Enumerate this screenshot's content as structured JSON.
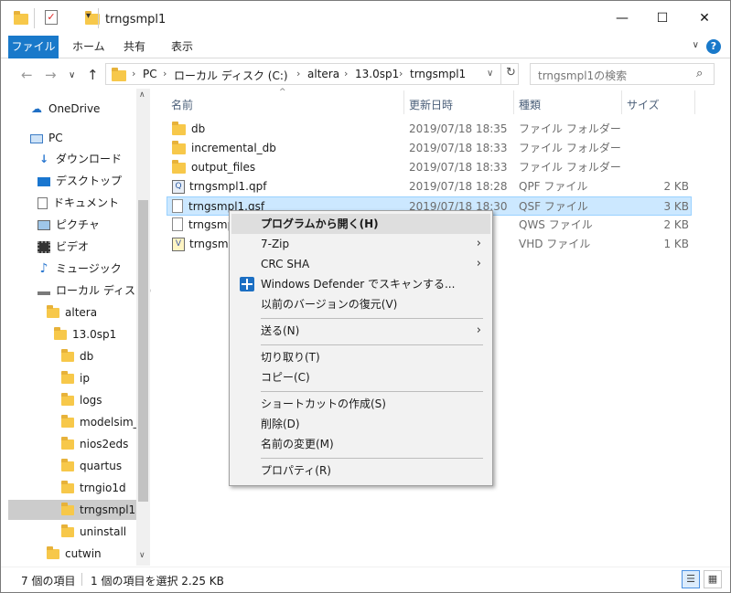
{
  "window": {
    "title": "trngsmpl1",
    "minimize": "—",
    "maximize": "☐",
    "close": "✕"
  },
  "ribbon": {
    "tabs": [
      "ファイル",
      "ホーム",
      "共有",
      "表示"
    ],
    "collapse": "∨",
    "help": "?"
  },
  "nav": {
    "back": "←",
    "forward": "→",
    "recent": "∨",
    "up": "↑"
  },
  "address": {
    "crumbs": [
      "PC",
      "ローカル ディスク (C:)",
      "altera",
      "13.0sp1",
      "trngsmpl1"
    ],
    "dropdown": "∨",
    "refresh": "↻"
  },
  "search": {
    "placeholder": "trngsmpl1の検索"
  },
  "navpane": {
    "items": [
      {
        "label": "OneDrive",
        "icon": "cloud-icon"
      },
      {
        "label": "PC",
        "icon": "computer-icon"
      },
      {
        "label": "ダウンロード",
        "icon": "download-icon"
      },
      {
        "label": "デスクトップ",
        "icon": "desktop-icon"
      },
      {
        "label": "ドキュメント",
        "icon": "document-icon"
      },
      {
        "label": "ピクチャ",
        "icon": "picture-icon"
      },
      {
        "label": "ビデオ",
        "icon": "video-icon"
      },
      {
        "label": "ミュージック",
        "icon": "music-icon"
      },
      {
        "label": "ローカル ディスク (C",
        "icon": "drive-icon"
      },
      {
        "label": "altera",
        "icon": "folder-icon"
      },
      {
        "label": "13.0sp1",
        "icon": "folder-icon"
      },
      {
        "label": "db",
        "icon": "folder-icon"
      },
      {
        "label": "ip",
        "icon": "folder-icon"
      },
      {
        "label": "logs",
        "icon": "folder-icon"
      },
      {
        "label": "modelsim_a",
        "icon": "folder-icon"
      },
      {
        "label": "nios2eds",
        "icon": "folder-icon"
      },
      {
        "label": "quartus",
        "icon": "folder-icon"
      },
      {
        "label": "trngio1d",
        "icon": "folder-icon"
      },
      {
        "label": "trngsmpl1",
        "icon": "folder-icon",
        "selected": true
      },
      {
        "label": "uninstall",
        "icon": "folder-icon"
      },
      {
        "label": "cutwin",
        "icon": "folder-icon"
      }
    ],
    "scroll_up": "∧",
    "scroll_down": "∨"
  },
  "columns": {
    "name": "名前",
    "modified": "更新日時",
    "type": "種類",
    "size": "サイズ",
    "sort_indicator": "^"
  },
  "files": [
    {
      "name": "db",
      "modified": "2019/07/18 18:35",
      "type": "ファイル フォルダー",
      "size": "",
      "icon": "folder-icon"
    },
    {
      "name": "incremental_db",
      "modified": "2019/07/18 18:33",
      "type": "ファイル フォルダー",
      "size": "",
      "icon": "folder-icon"
    },
    {
      "name": "output_files",
      "modified": "2019/07/18 18:33",
      "type": "ファイル フォルダー",
      "size": "",
      "icon": "folder-icon"
    },
    {
      "name": "trngsmpl1.qpf",
      "modified": "2019/07/18 18:28",
      "type": "QPF ファイル",
      "size": "2 KB",
      "icon": "qpf-file-icon"
    },
    {
      "name": "trngsmpl1.qsf",
      "modified": "2019/07/18 18:30",
      "type": "QSF ファイル",
      "size": "3 KB",
      "icon": "file-icon",
      "selected": true
    },
    {
      "name": "trngsmp",
      "modified": "",
      "type": "QWS ファイル",
      "size": "2 KB",
      "icon": "file-icon"
    },
    {
      "name": "trngsmp",
      "modified": "",
      "type": "VHD ファイル",
      "size": "1 KB",
      "icon": "vhd-file-icon"
    }
  ],
  "context_menu": {
    "items": [
      {
        "label": "プログラムから開く(H)",
        "highlighted": true
      },
      {
        "label": "7-Zip",
        "submenu": true
      },
      {
        "label": "CRC SHA",
        "submenu": true
      },
      {
        "label": "Windows Defender でスキャンする...",
        "icon": "defender-icon"
      },
      {
        "label": "以前のバージョンの復元(V)"
      },
      {
        "label": "送る(N)",
        "submenu": true
      },
      {
        "label": "切り取り(T)"
      },
      {
        "label": "コピー(C)"
      },
      {
        "label": "ショートカットの作成(S)"
      },
      {
        "label": "削除(D)"
      },
      {
        "label": "名前の変更(M)"
      },
      {
        "label": "プロパティ(R)"
      }
    ],
    "submenu_arrow": "›"
  },
  "status": {
    "count": "7 個の項目",
    "selection": "1 個の項目を選択  2.25 KB",
    "view_details": "☰",
    "view_icons": "▦"
  },
  "colors": {
    "accent": "#1979ca",
    "selection": "#cce8ff",
    "folder": "#f7c84a"
  }
}
